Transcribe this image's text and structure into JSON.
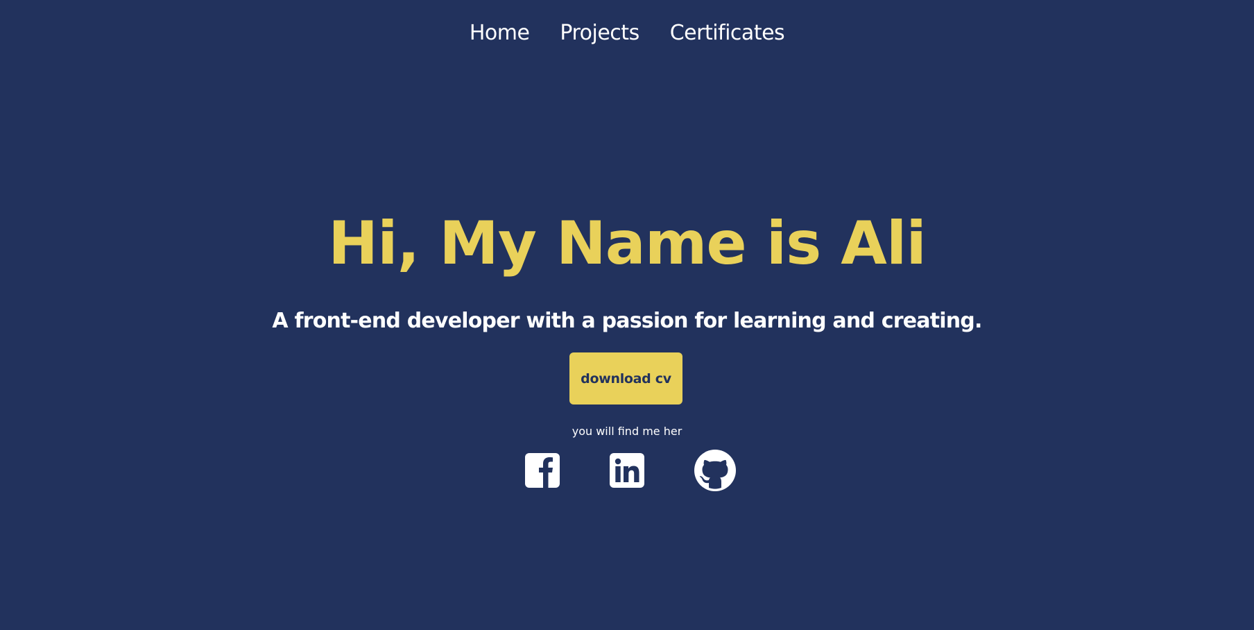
{
  "nav": {
    "items": [
      {
        "label": "Home"
      },
      {
        "label": "Projects"
      },
      {
        "label": "Certificates"
      }
    ]
  },
  "hero": {
    "title": "Hi, My Name is Ali",
    "subtitle": "A front-end developer with a passion for learning and creating.",
    "cta_label": "download cv",
    "social_caption": "you will find me her"
  },
  "socials": {
    "items": [
      {
        "icon": "facebook-icon"
      },
      {
        "icon": "linkedin-icon"
      },
      {
        "icon": "github-icon"
      }
    ]
  },
  "colors": {
    "background": "#22325d",
    "accent": "#e9d15a",
    "text": "#ffffff"
  }
}
